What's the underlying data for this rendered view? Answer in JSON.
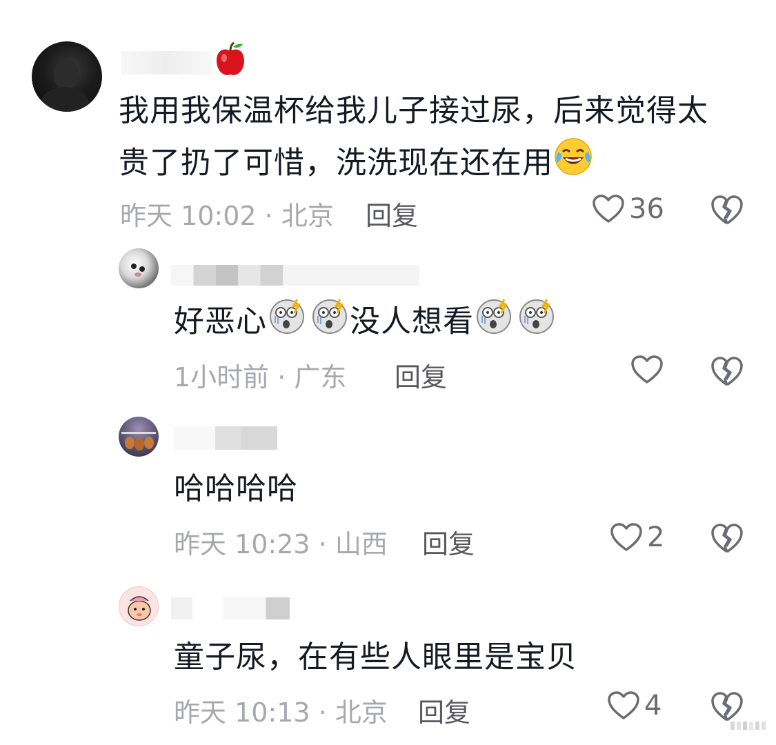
{
  "comments": [
    {
      "text_line1": "我用我保温杯给我儿子接过尿，后来觉得太",
      "text_line2": "贵了扔了可惜，洗洗现在还在用",
      "time": "昨天 10:02 · 北京",
      "reply": "回复",
      "likes": "36"
    },
    {
      "text_a": "好恶心",
      "text_b": "没人想看",
      "time": "1小时前 · 广东",
      "reply": "回复",
      "likes": ""
    },
    {
      "text": "哈哈哈哈",
      "time": "昨天 10:23 · 山西",
      "reply": "回复",
      "likes": "2"
    },
    {
      "text": "童子尿，在有些人眼里是宝贝",
      "time": "昨天 10:13 · 北京",
      "reply": "回复",
      "likes": "4"
    }
  ],
  "icons": {
    "like": "heart-outline-icon",
    "dislike": "broken-heart-icon",
    "badge": "apple-icon",
    "emoji_laugh": "face-tears-of-joy-icon",
    "emoji_shock": "shocked-face-icon"
  },
  "colors": {
    "text": "#161823",
    "meta": "#a7a8ad",
    "reply": "#58595f",
    "icon": "#6b6c72"
  }
}
